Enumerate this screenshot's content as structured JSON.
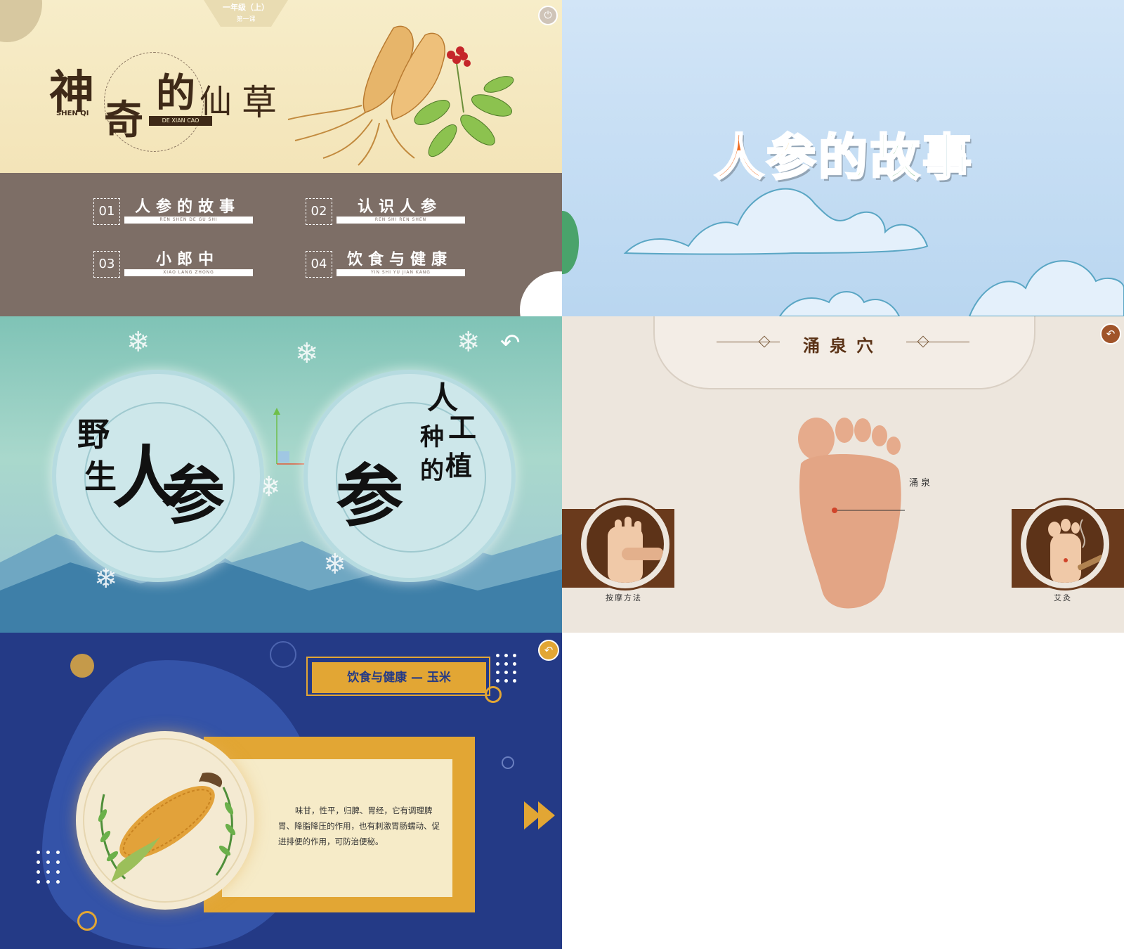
{
  "panels": {
    "title_menu": {
      "grade": "一年级（上）",
      "lesson": "第一课",
      "title_chars": [
        "神",
        "奇",
        "的",
        "仙",
        "草"
      ],
      "pinyin_shenqi": "SHEN QI",
      "pinyin_dexiancao": "DE XIAN CAO",
      "menu": [
        {
          "num": "01",
          "label": "人参的故事",
          "pinyin": "REN SHEN DE GU SHI"
        },
        {
          "num": "02",
          "label": "认识人参",
          "pinyin": "REN SHI REN SHEN"
        },
        {
          "num": "03",
          "label": "小郎中",
          "pinyin": "XIAO LANG ZHONG"
        },
        {
          "num": "04",
          "label": "饮食与健康",
          "pinyin": "YIN SHI YU JIAN KANG"
        }
      ],
      "icons": {
        "power": "power-icon",
        "illustration": "ginseng-root-illustration"
      },
      "colors": {
        "bg_top": "#f7edc9",
        "bg_bottom": "#7d6e66",
        "title": "#3f2a18"
      }
    },
    "story_title": {
      "title_chars": [
        {
          "char": "人",
          "color": "#ef6a1f"
        },
        {
          "char": "参",
          "color": "#f5b21a"
        },
        {
          "char": "的",
          "color": "#6dbb2f"
        },
        {
          "char": "故",
          "color": "#2f8f45"
        },
        {
          "char": "事",
          "color": "#1f7f8c"
        }
      ],
      "colors": {
        "sky": "#c6def4"
      }
    },
    "wild_vs_cultivated": {
      "left_disc_chars": [
        "野",
        "生",
        "人",
        "参"
      ],
      "right_disc_chars": [
        "人",
        "工",
        "种",
        "植",
        "的",
        "参"
      ],
      "icons": {
        "back": "back-arrow-icon",
        "snowflake": "snowflake-icon"
      }
    },
    "acupoint": {
      "title": "涌泉穴",
      "point_label": "涌泉",
      "left_method": "按摩方法",
      "right_method": "艾灸",
      "icons": {
        "back": "back-arrow-icon"
      },
      "colors": {
        "brown": "#6a3a1c",
        "bg": "#ede6dd"
      }
    },
    "diet": {
      "header": "饮食与健康 — 玉米",
      "description": "味甘，性平，归脾、胃经，它有调理脾胃、降脂降压的作用，也有刺激胃肠蠕动、促进排便的作用，可防治便秘。",
      "icons": {
        "back": "back-arrow-icon",
        "next": "play-next-icon"
      },
      "colors": {
        "bg": "#243a86",
        "accent": "#e2a634",
        "card": "#f6ebc8"
      }
    }
  }
}
